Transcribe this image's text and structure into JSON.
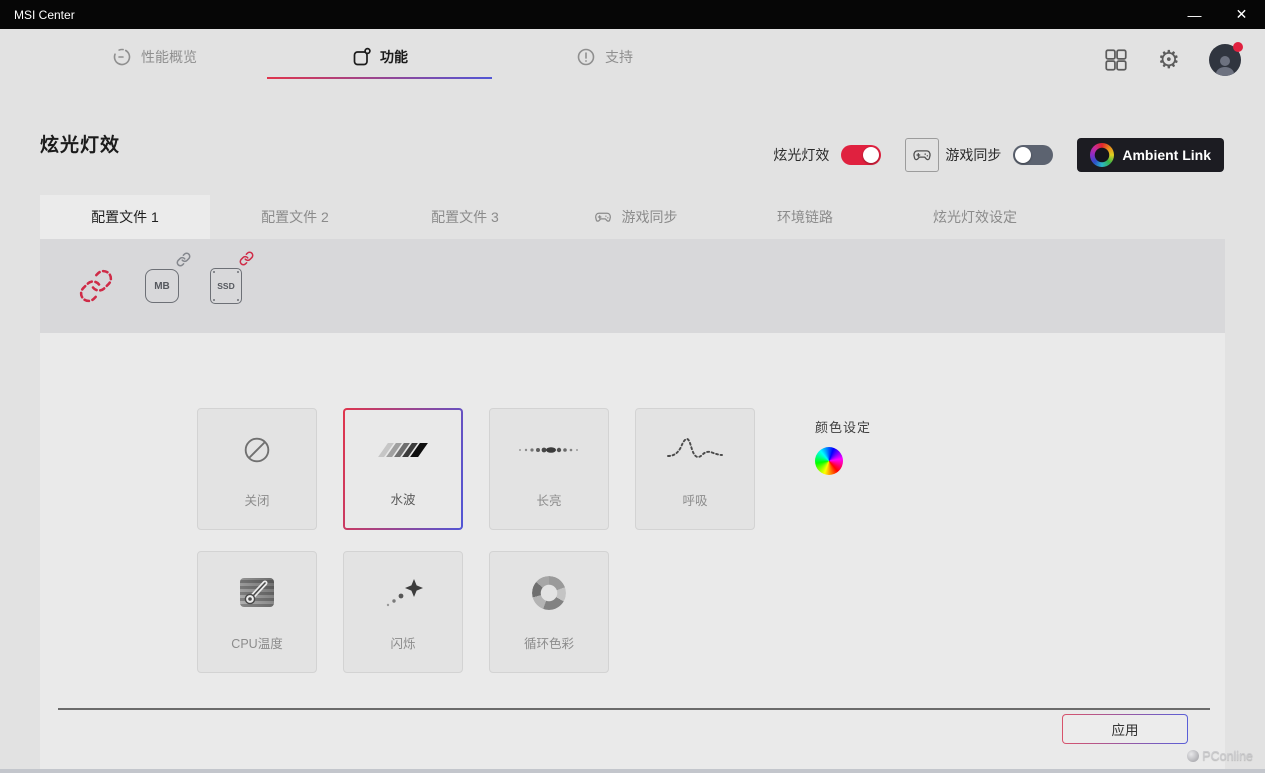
{
  "window": {
    "title": "MSI Center",
    "minimize_glyph": "—",
    "close_glyph": "✕"
  },
  "nav": {
    "items": [
      {
        "label": "性能概览"
      },
      {
        "label": "功能"
      },
      {
        "label": "支持"
      }
    ]
  },
  "header": {
    "page_title": "炫光灯效",
    "mystic_toggle_label": "炫光灯效",
    "mystic_toggle_state": "on",
    "game_sync_label": "游戏同步",
    "game_sync_state": "off",
    "ambient_link_label": "Ambient Link"
  },
  "tabs": [
    {
      "label": "配置文件 1"
    },
    {
      "label": "配置文件 2"
    },
    {
      "label": "配置文件 3"
    },
    {
      "label": "游戏同步"
    },
    {
      "label": "环境链路"
    },
    {
      "label": "炫光灯效设定"
    }
  ],
  "devices": [
    {
      "name": "link-all",
      "label": ""
    },
    {
      "name": "motherboard",
      "label": "MB"
    },
    {
      "name": "ssd",
      "label": "SSD"
    }
  ],
  "effects": [
    {
      "label": "关闭"
    },
    {
      "label": "水波",
      "selected": true
    },
    {
      "label": "长亮"
    },
    {
      "label": "呼吸"
    },
    {
      "label": "CPU温度"
    },
    {
      "label": "闪烁"
    },
    {
      "label": "循环色彩"
    }
  ],
  "color_setting": {
    "label": "颜色设定"
  },
  "footer": {
    "apply_label": "应用"
  },
  "watermark": {
    "text": "PConline"
  },
  "colors": {
    "accent_red": "#e0213f",
    "accent_blue": "#5156d6",
    "titlebar_bg": "#060606",
    "toggle_off_bg": "#5c6370",
    "device_band_bg": "#d8d8da",
    "panel_bg": "#eaeaea"
  }
}
